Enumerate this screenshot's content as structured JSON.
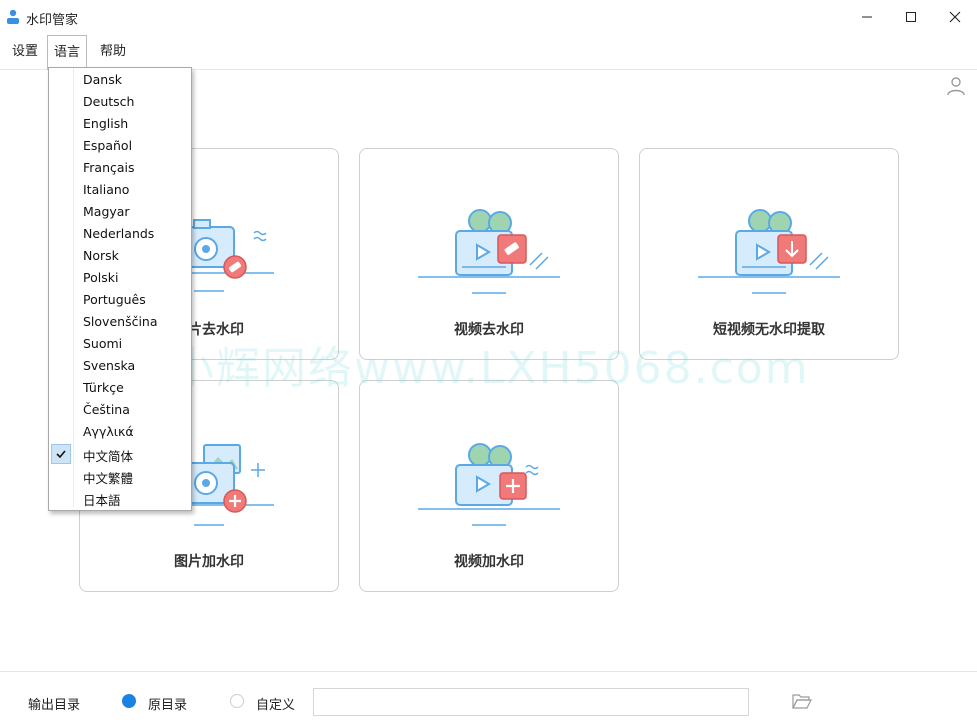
{
  "window": {
    "title": "水印管家"
  },
  "menu": {
    "settings": "设置",
    "language": "语言",
    "help": "帮助"
  },
  "language_menu": {
    "items": [
      "Dansk",
      "Deutsch",
      "English",
      "Español",
      "Français",
      "Italiano",
      "Magyar",
      "Nederlands",
      "Norsk",
      "Polski",
      "Português",
      "Slovenščina",
      "Suomi",
      "Svenska",
      "Türkçe",
      "Čeština",
      "Αγγλικά",
      "中文简体",
      "中文繁體",
      "日本語"
    ],
    "selected": "中文简体"
  },
  "cards": [
    {
      "label": "图片去水印",
      "icon": "camera-eraser-icon"
    },
    {
      "label": "视频去水印",
      "icon": "video-eraser-icon"
    },
    {
      "label": "短视频无水印提取",
      "icon": "video-download-icon"
    },
    {
      "label": "图片加水印",
      "icon": "camera-plus-icon"
    },
    {
      "label": "视频加水印",
      "icon": "video-plus-icon"
    }
  ],
  "watermark_text": "小辉网络www.LXH5068.com",
  "footer": {
    "output_label": "输出目录",
    "option_original": "原目录",
    "option_custom": "自定义",
    "selected_option": "原目录",
    "path_value": ""
  },
  "colors": {
    "accent": "#1a82e2",
    "illustration_blue": "#5aa9e6",
    "illustration_red": "#f07a7a",
    "illustration_green": "#9fd4b0"
  }
}
